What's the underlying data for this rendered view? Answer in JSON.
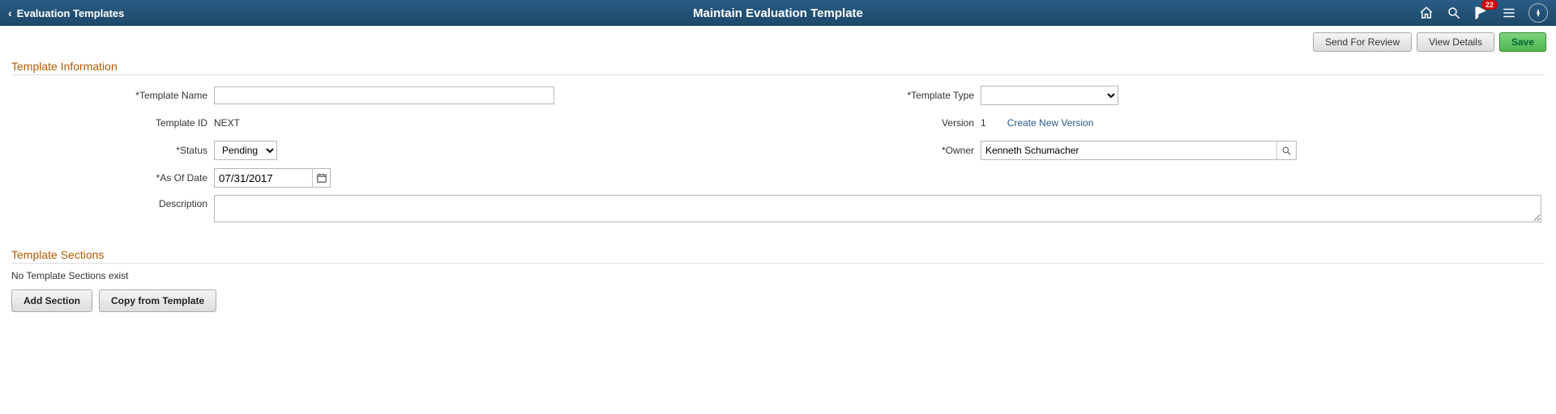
{
  "header": {
    "back_label": "Evaluation Templates",
    "title": "Maintain Evaluation Template",
    "notification_count": "22"
  },
  "actions": {
    "send_review": "Send For Review",
    "view_details": "View Details",
    "save": "Save"
  },
  "section_titles": {
    "info": "Template Information",
    "sections": "Template Sections"
  },
  "labels": {
    "template_name": "Template Name",
    "template_id": "Template ID",
    "status": "Status",
    "as_of_date": "As Of Date",
    "description": "Description",
    "template_type": "Template Type",
    "version": "Version",
    "create_new_version": "Create New Version",
    "owner": "Owner"
  },
  "values": {
    "template_name": "",
    "template_id": "NEXT",
    "status": "Pending",
    "as_of_date": "07/31/2017",
    "description": "",
    "template_type": "",
    "version": "1",
    "owner": "Kenneth Schumacher"
  },
  "sections": {
    "empty_msg": "No Template Sections exist",
    "add_section": "Add Section",
    "copy_from_template": "Copy from Template"
  }
}
